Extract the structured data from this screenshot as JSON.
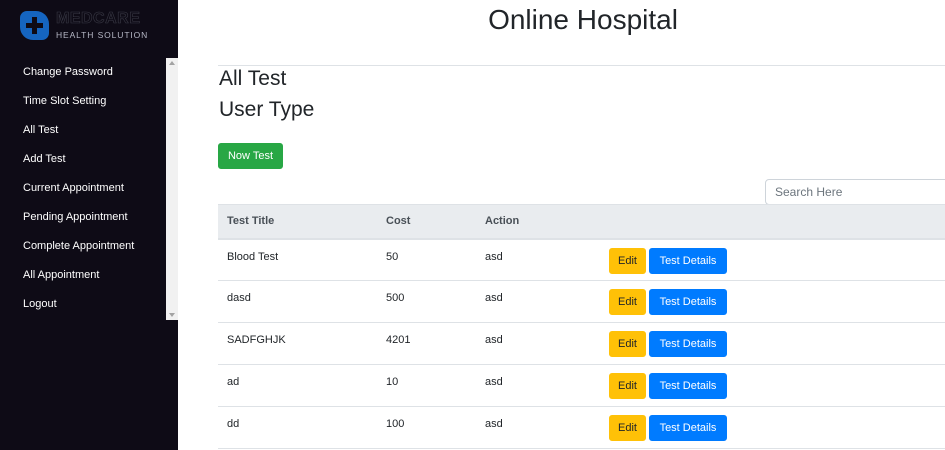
{
  "brand": {
    "title": "MEDCARE",
    "subtitle": "HEALTH SOLUTION"
  },
  "sidebar": {
    "items": [
      {
        "label": "Change Password"
      },
      {
        "label": "Time Slot Setting"
      },
      {
        "label": "All Test"
      },
      {
        "label": "Add Test"
      },
      {
        "label": "Current Appointment"
      },
      {
        "label": "Pending Appointment"
      },
      {
        "label": "Complete Appointment"
      },
      {
        "label": "All Appointment"
      },
      {
        "label": "Logout"
      }
    ]
  },
  "header": {
    "title": "Online Hospital"
  },
  "main": {
    "heading1": "All Test",
    "heading2": "User Type",
    "new_button": "Now Test",
    "search": {
      "placeholder": "Search Here",
      "value": ""
    },
    "table": {
      "columns": [
        "Test Title",
        "Cost",
        "Action"
      ],
      "rows": [
        {
          "title": "Blood Test",
          "cost": "50",
          "action": "asd"
        },
        {
          "title": "dasd",
          "cost": "500",
          "action": "asd"
        },
        {
          "title": "SADFGHJK",
          "cost": "4201",
          "action": "asd"
        },
        {
          "title": "ad",
          "cost": "10",
          "action": "asd"
        },
        {
          "title": "dd",
          "cost": "100",
          "action": "asd"
        }
      ],
      "edit_label": "Edit",
      "details_label": "Test Details"
    }
  },
  "colors": {
    "sidebar_bg": "#0e0b16",
    "logo_blue": "#1565c0",
    "success": "#28a745",
    "warning": "#ffc107",
    "primary": "#007bff"
  },
  "icons": {
    "logo": "medical-cross-icon"
  }
}
